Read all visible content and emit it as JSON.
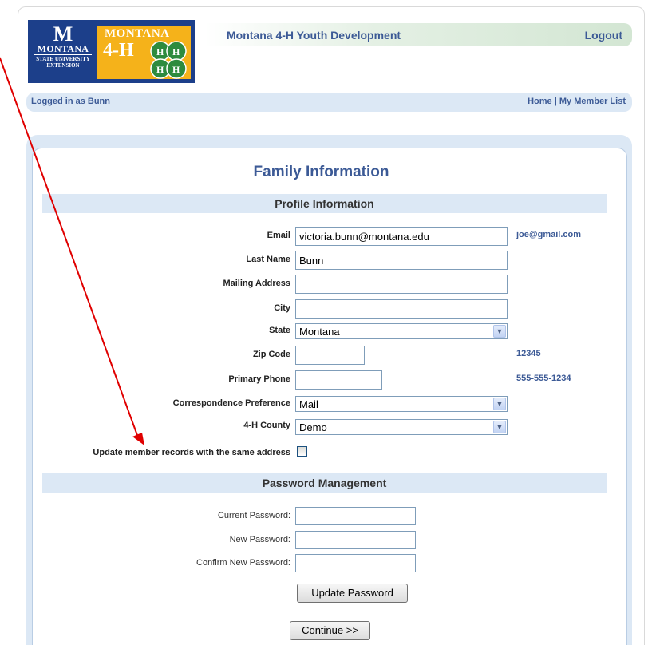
{
  "header": {
    "logo": {
      "msu_mark": "M",
      "msu_line1": "MONTANA",
      "msu_line2": "STATE UNIVERSITY",
      "msu_line3": "EXTENSION",
      "fourh_line1": "MONTANA",
      "fourh_line2": "4-H"
    },
    "site_title": "Montana 4-H Youth Development",
    "logout_label": "Logout"
  },
  "userbar": {
    "logged_in_text": "Logged in as Bunn",
    "nav_links": "Home | My Member List"
  },
  "page_title": "Family Information",
  "profile": {
    "section_title": "Profile Information",
    "fields": {
      "email": {
        "label": "Email",
        "value": "victoria.bunn@montana.edu",
        "hint": "joe@gmail.com"
      },
      "last_name": {
        "label": "Last Name",
        "value": "Bunn"
      },
      "mailing_address": {
        "label": "Mailing Address",
        "value": ""
      },
      "city": {
        "label": "City",
        "value": ""
      },
      "state": {
        "label": "State",
        "selected": "Montana"
      },
      "zip": {
        "label": "Zip Code",
        "value": "",
        "hint": "12345"
      },
      "phone": {
        "label": "Primary Phone",
        "value": "",
        "hint": "555-555-1234"
      },
      "correspondence": {
        "label": "Correspondence Preference",
        "selected": "Mail"
      },
      "county": {
        "label": "4-H County",
        "selected": "Demo"
      }
    },
    "update_records_label": "Update member records with the same address",
    "update_records_checked": false
  },
  "password": {
    "section_title": "Password Management",
    "current_label": "Current Password:",
    "new_label": "New Password:",
    "confirm_label": "Confirm New Password:",
    "update_button": "Update Password"
  },
  "continue_button": "Continue >>",
  "colors": {
    "accent_text": "#3c5a96",
    "section_bg": "#dce8f5",
    "logo_blue": "#1c3f8a",
    "logo_gold": "#f5b21a",
    "annotation_arrow": "#e00000"
  }
}
